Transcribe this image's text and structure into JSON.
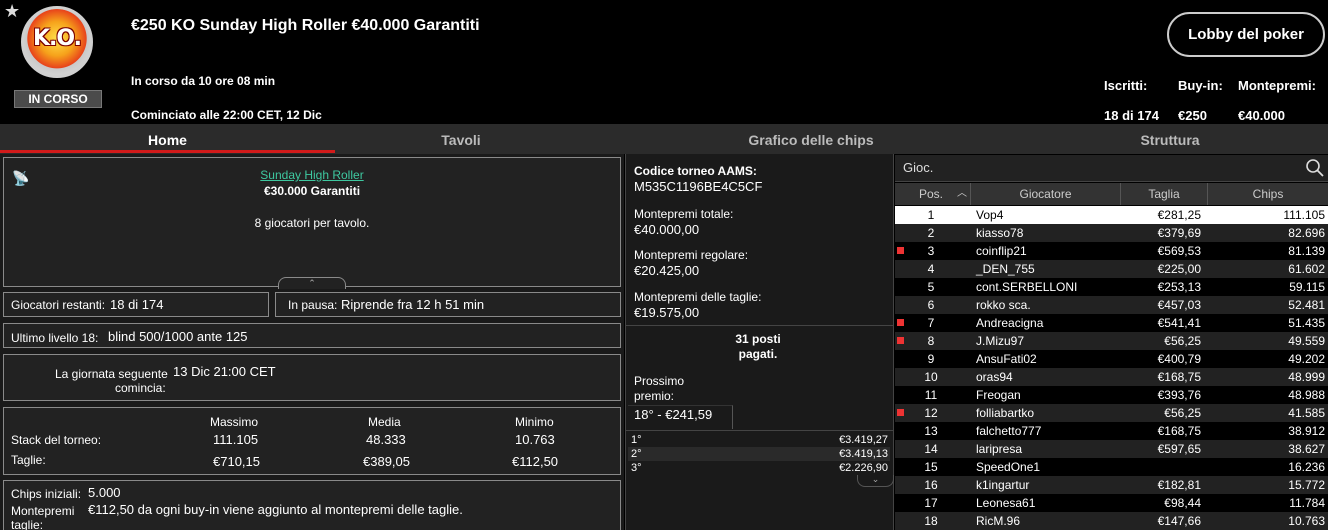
{
  "header": {
    "status": "IN CORSO",
    "logo_text": "K.O.",
    "title": "€250 KO Sunday High Roller €40.000 Garantiti",
    "running": "In corso da 10 ore 08 min",
    "started": "Cominciato alle 22:00 CET, 12 Dic",
    "lobby_button": "Lobby del poker",
    "stats": [
      {
        "label": "Iscritti:",
        "value": "18 di 174"
      },
      {
        "label": "Buy-in:",
        "value": "€250"
      },
      {
        "label": "Montepremi:",
        "value": "€40.000"
      }
    ]
  },
  "tabs": [
    "Home",
    "Tavoli",
    "Grafico delle chips",
    "Struttura"
  ],
  "left": {
    "link": "Sunday High Roller",
    "guaranteed": "€30.000 Garantiti",
    "per_table": "8 giocatori per tavolo.",
    "remaining_label": "Giocatori restanti:",
    "remaining_value": "18 di 174",
    "pause_label": "In pausa:",
    "pause_value": "Riprende fra 12 h 51 min",
    "level_label": "Ultimo livello 18:",
    "level_value": "blind 500/1000 ante 125",
    "nextday_label1": "La giornata seguente",
    "nextday_label2": "comincia:",
    "nextday_value": "13 Dic 21:00 CET",
    "stack_headers": [
      "Massimo",
      "Media",
      "Minimo"
    ],
    "stack_label": "Stack del torneo:",
    "stack_values": [
      "111.105",
      "48.333",
      "10.763"
    ],
    "bounty_label": "Taglie:",
    "bounty_values": [
      "€710,15",
      "€389,05",
      "€112,50"
    ],
    "chips_label": "Chips iniziali:",
    "chips_value": "5.000",
    "bounty_pool_label1": "Montepremi",
    "bounty_pool_label2": "taglie:",
    "bounty_pool_value": "€112,50 da ogni buy-in viene aggiunto al montepremi delle taglie."
  },
  "middle": {
    "code_label": "Codice torneo AAMS:",
    "code_value": "M535C1196BE4C5CF",
    "total_label": "Montepremi totale:",
    "total_value": "€40.000,00",
    "regular_label": "Montepremi regolare:",
    "regular_value": "€20.425,00",
    "bounty_label": "Montepremi delle taglie:",
    "bounty_value": "€19.575,00",
    "paid1": "31 posti",
    "paid2": "pagati.",
    "next_label1": "Prossimo",
    "next_label2": "premio:",
    "next_value": "18° - €241,59",
    "prizes": [
      {
        "pos": "1°",
        "amount": "€3.419,27"
      },
      {
        "pos": "2°",
        "amount": "€3.419,13"
      },
      {
        "pos": "3°",
        "amount": "€2.226,90"
      }
    ]
  },
  "players": {
    "search_placeholder": "Gioc.",
    "headers": [
      "Pos.",
      "Giocatore",
      "Taglia",
      "Chips"
    ],
    "rows": [
      {
        "pos": "1",
        "name": "Vop4",
        "bounty": "€281,25",
        "chips": "111.105",
        "flag": false
      },
      {
        "pos": "2",
        "name": "kiasso78",
        "bounty": "€379,69",
        "chips": "82.696",
        "flag": false
      },
      {
        "pos": "3",
        "name": "coinflip21",
        "bounty": "€569,53",
        "chips": "81.139",
        "flag": true
      },
      {
        "pos": "4",
        "name": "_DEN_755",
        "bounty": "€225,00",
        "chips": "61.602",
        "flag": false
      },
      {
        "pos": "5",
        "name": "cont.SERBELLONI",
        "bounty": "€253,13",
        "chips": "59.115",
        "flag": false
      },
      {
        "pos": "6",
        "name": "rokko sca.",
        "bounty": "€457,03",
        "chips": "52.481",
        "flag": false
      },
      {
        "pos": "7",
        "name": "Andreacigna",
        "bounty": "€541,41",
        "chips": "51.435",
        "flag": true
      },
      {
        "pos": "8",
        "name": "J.Mizu97",
        "bounty": "€56,25",
        "chips": "49.559",
        "flag": true
      },
      {
        "pos": "9",
        "name": "AnsuFati02",
        "bounty": "€400,79",
        "chips": "49.202",
        "flag": false
      },
      {
        "pos": "10",
        "name": "oras94",
        "bounty": "€168,75",
        "chips": "48.999",
        "flag": false
      },
      {
        "pos": "11",
        "name": "Freogan",
        "bounty": "€393,76",
        "chips": "48.988",
        "flag": false
      },
      {
        "pos": "12",
        "name": "folliabartko",
        "bounty": "€56,25",
        "chips": "41.585",
        "flag": true
      },
      {
        "pos": "13",
        "name": "falchetto777",
        "bounty": "€168,75",
        "chips": "38.912",
        "flag": false
      },
      {
        "pos": "14",
        "name": "laripresa",
        "bounty": "€597,65",
        "chips": "38.627",
        "flag": false
      },
      {
        "pos": "15",
        "name": "SpeedOne1",
        "bounty": "",
        "chips": "16.236",
        "flag": false
      },
      {
        "pos": "16",
        "name": "k1ingartur",
        "bounty": "€182,81",
        "chips": "15.772",
        "flag": false
      },
      {
        "pos": "17",
        "name": "Leonesa61",
        "bounty": "€98,44",
        "chips": "11.784",
        "flag": false
      },
      {
        "pos": "18",
        "name": "RicM.96",
        "bounty": "€147,66",
        "chips": "10.763",
        "flag": false
      }
    ]
  }
}
